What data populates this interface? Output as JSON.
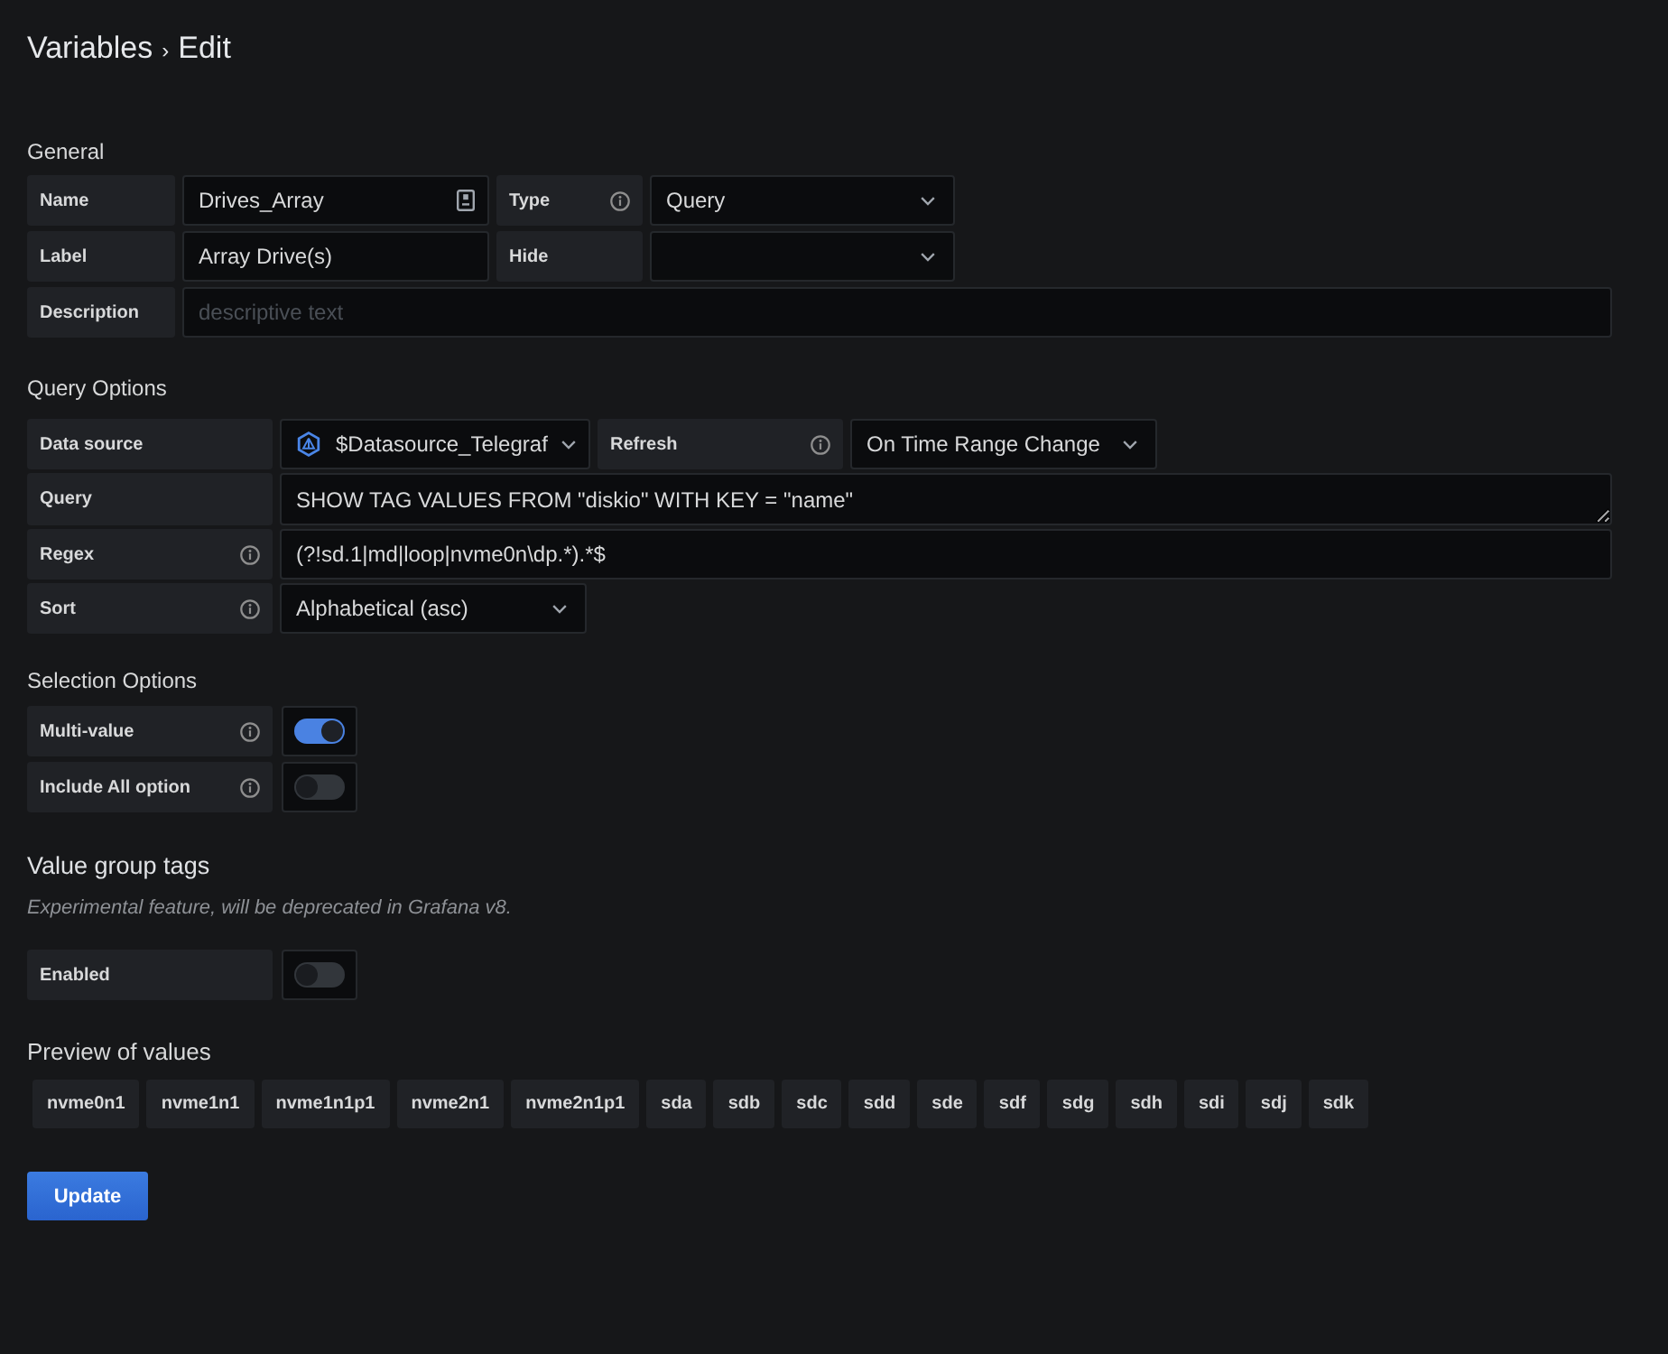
{
  "breadcrumb": {
    "parent": "Variables",
    "separator": "›",
    "current": "Edit"
  },
  "general": {
    "heading": "General",
    "name": {
      "label": "Name",
      "info": false,
      "value": "Drives_Array"
    },
    "type": {
      "label": "Type",
      "info": true,
      "value": "Query"
    },
    "label": {
      "label": "Label",
      "info": false,
      "value": "Array Drive(s)"
    },
    "hide": {
      "label": "Hide",
      "info": false
    },
    "description": {
      "label": "Description",
      "info": false,
      "placeholder": "descriptive text"
    }
  },
  "query_options": {
    "heading": "Query Options",
    "data_source": {
      "label": "Data source",
      "info": false,
      "value": "$Datasource_Telegraf"
    },
    "refresh": {
      "label": "Refresh",
      "info": true,
      "value": "On Time Range Change"
    },
    "query": {
      "label": "Query",
      "info": false,
      "value": "SHOW TAG VALUES FROM \"diskio\" WITH KEY = \"name\""
    },
    "regex": {
      "label": "Regex",
      "info": true,
      "value": "(?!sd.1|md|loop|nvme0n\\dp.*).*$"
    },
    "sort": {
      "label": "Sort",
      "info": true,
      "value": "Alphabetical (asc)"
    }
  },
  "selection_options": {
    "heading": "Selection Options",
    "toggles": [
      {
        "label": "Multi-value",
        "info": true,
        "on": true
      },
      {
        "label": "Include All option",
        "info": true,
        "on": false
      }
    ]
  },
  "value_group_tags": {
    "heading": "Value group tags",
    "description": "Experimental feature, will be deprecated in Grafana v8.",
    "toggles": [
      {
        "label": "Enabled",
        "info": false,
        "on": false
      }
    ]
  },
  "preview": {
    "heading": "Preview of values",
    "values": [
      "nvme0n1",
      "nvme1n1",
      "nvme1n1p1",
      "nvme2n1",
      "nvme2n1p1",
      "sda",
      "sdb",
      "sdc",
      "sdd",
      "sde",
      "sdf",
      "sdg",
      "sdh",
      "sdi",
      "sdj",
      "sdk"
    ]
  },
  "update_button": "Update"
}
